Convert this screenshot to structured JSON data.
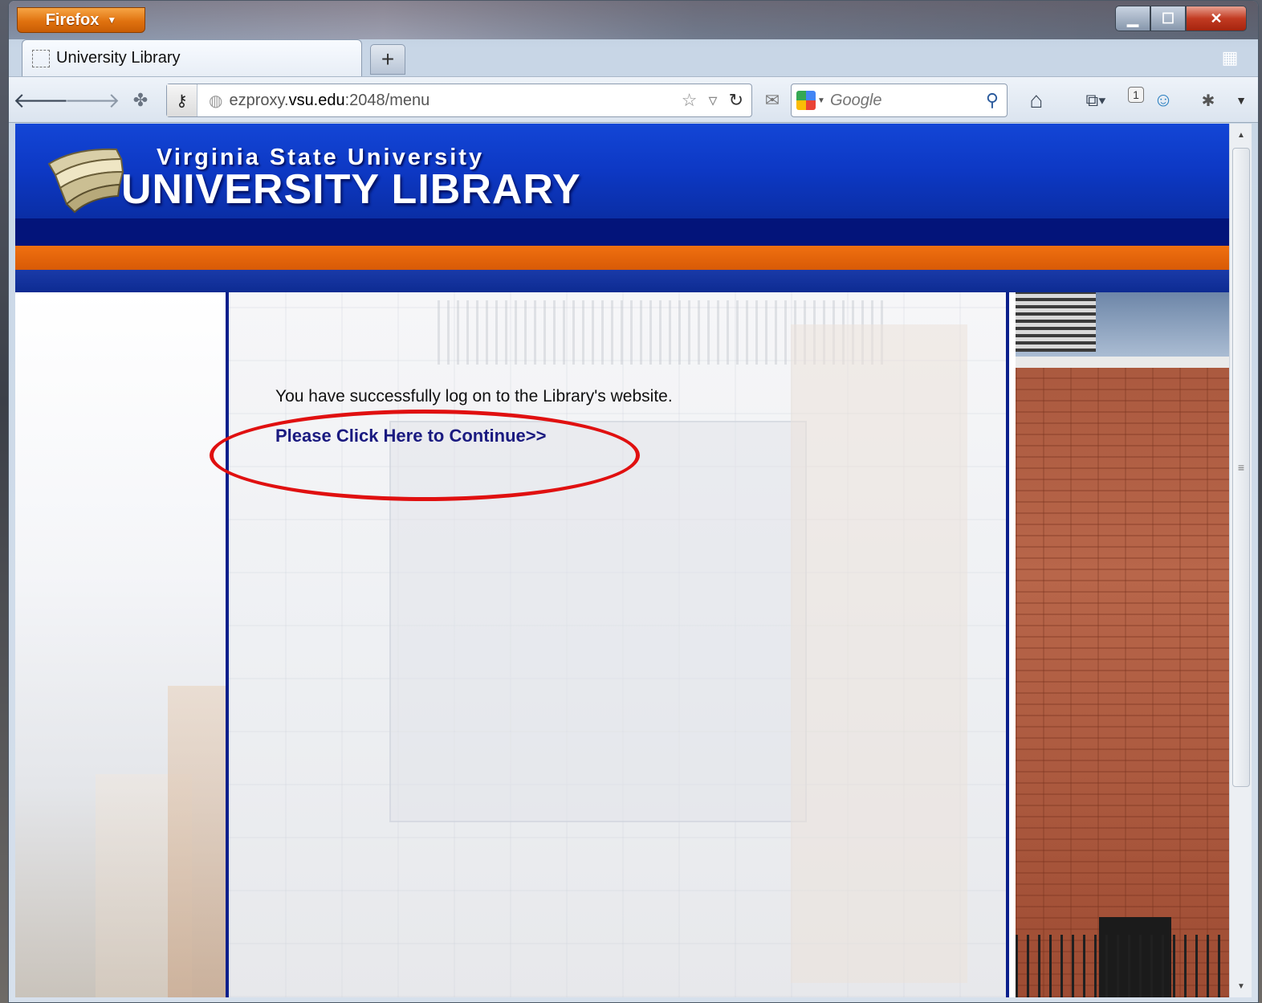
{
  "browser": {
    "app_button_label": "Firefox",
    "tab_title": "University Library",
    "new_tab_label": "+",
    "url": {
      "prefix": "ezproxy.",
      "host": "vsu.edu",
      "suffix": ":2048/menu"
    },
    "search_placeholder": "Google",
    "notification_count": "1"
  },
  "page": {
    "header_subtitle": "Virginia State University",
    "header_title": "UNIVERSITY LIBRARY",
    "success_message": "You have successfully log on to the Library's website.",
    "continue_link": "Please Click Here to Continue>>"
  },
  "colors": {
    "banner_blue": "#0d38c4",
    "banner_navy": "#03147a",
    "banner_orange": "#e0620a",
    "link": "#1a1a80",
    "annotation_red": "#e01010"
  },
  "icons": {
    "back": "back-arrow-icon",
    "forward": "forward-arrow-icon",
    "home": "home-icon",
    "bookmark_star": "star-icon",
    "reload": "reload-icon",
    "search": "magnifier-icon"
  }
}
